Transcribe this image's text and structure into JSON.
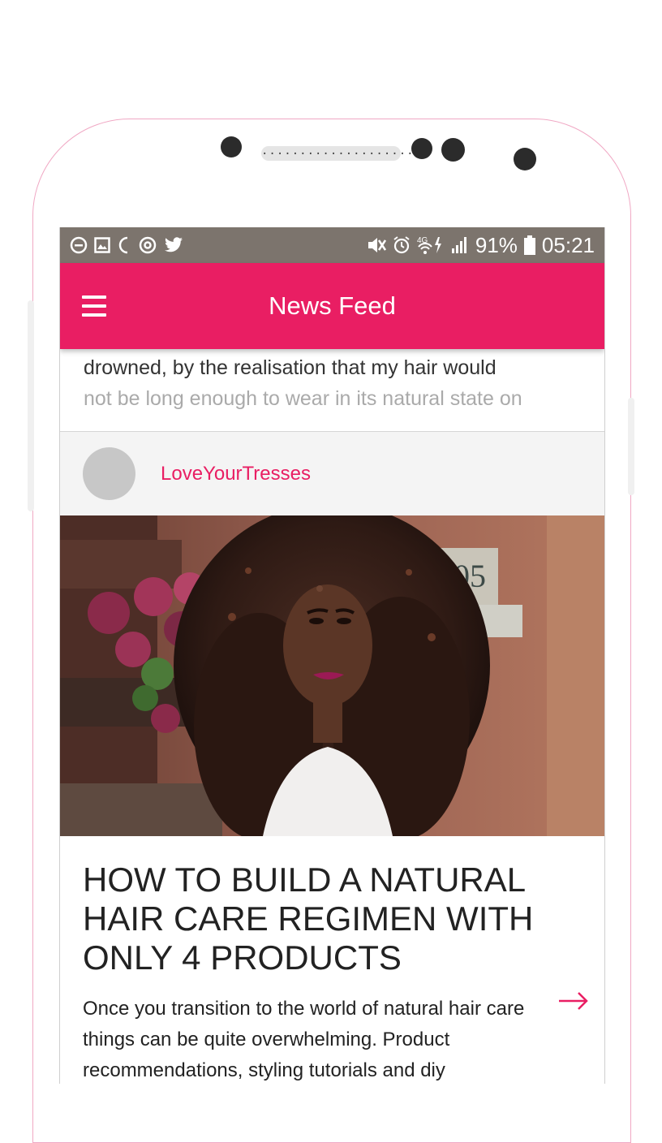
{
  "status_bar": {
    "left_icons": [
      "do-not-disturb-icon",
      "gallery-icon",
      "moon-icon",
      "sync-icon",
      "twitter-icon"
    ],
    "right_icons": [
      "mute-icon",
      "alarm-icon",
      "wifi-4g-icon",
      "signal-icon"
    ],
    "battery_percent": "91%",
    "time": "05:21"
  },
  "app_bar": {
    "title": "News Feed"
  },
  "snippet": {
    "line1": "drowned, by the realisation that my hair would",
    "line2": "not be long enough to wear in its natural state on"
  },
  "post": {
    "author": "LoveYourTresses",
    "house_number": "405",
    "headline": "HOW TO BUILD A NATURAL HAIR CARE REGIMEN WITH ONLY 4 PRODUCTS",
    "excerpt": "Once you transition to the world of natural hair care things can be quite overwhelming. Product recommendations, styling tutorials and diy"
  },
  "colors": {
    "accent": "#e91e63",
    "status_bar": "#7c746d"
  }
}
